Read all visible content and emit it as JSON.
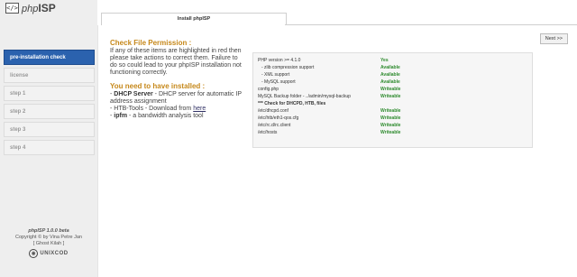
{
  "app": {
    "logo_box": "</>",
    "logo_prefix": "php",
    "logo_suffix": "ISP"
  },
  "tab": {
    "label": "Install phpISP"
  },
  "nav": [
    {
      "label": "pre-installation check",
      "active": true
    },
    {
      "label": "license",
      "active": false
    },
    {
      "label": "step 1",
      "active": false
    },
    {
      "label": "step 2",
      "active": false
    },
    {
      "label": "step 3",
      "active": false
    },
    {
      "label": "step 4",
      "active": false
    }
  ],
  "footer": {
    "version": "phpISP 1.0.0 beta",
    "copyright": "Copyright © by Vina Petre Jan",
    "author": "[ Ghost Kilah ]",
    "company": "UNIXCOD"
  },
  "next_button": "Next >>",
  "main": {
    "heading1": "Check File Permission :",
    "para1": "If any of these items are highlighted in red then please take actions to correct them. Failure to do so could lead to your phpISP installation not functioning correctly.",
    "heading2": "You need to have installed :",
    "req1_name": "DHCP Server",
    "req1_desc": " - DHCP server for automatic IP address assignment",
    "req2_prefix": "- HTB-Tools - Download from ",
    "req2_link": "here",
    "req3_name": "ipfm",
    "req3_desc": " - a bandwidth analysis tool"
  },
  "checks": [
    {
      "label": "PHP version >= 4.1.0",
      "value": "Yes",
      "sub": false
    },
    {
      "label": "- zlib compression support",
      "value": "Available",
      "sub": true
    },
    {
      "label": "- XML support",
      "value": "Available",
      "sub": true
    },
    {
      "label": "- MySQL support",
      "value": "Available",
      "sub": true
    },
    {
      "label": "config.php",
      "value": "Writeable",
      "sub": false
    },
    {
      "label": "MySQL Backup folder - ../admin/mysql-backup",
      "value": "Writeable",
      "sub": false
    },
    {
      "label": "*** Check for DHCPD, HTB, files",
      "value": "",
      "sub": false,
      "heading": true
    },
    {
      "label": "/etc/dhcpd.conf",
      "value": "Writeable",
      "sub": false
    },
    {
      "label": "/etc/htb/eth1-qos.cfg",
      "value": "Writeable",
      "sub": false
    },
    {
      "label": "/etc/rc.d/rc.client",
      "value": "Writeable",
      "sub": false
    },
    {
      "label": "/etc/hosts",
      "value": "Writeable",
      "sub": false
    }
  ]
}
